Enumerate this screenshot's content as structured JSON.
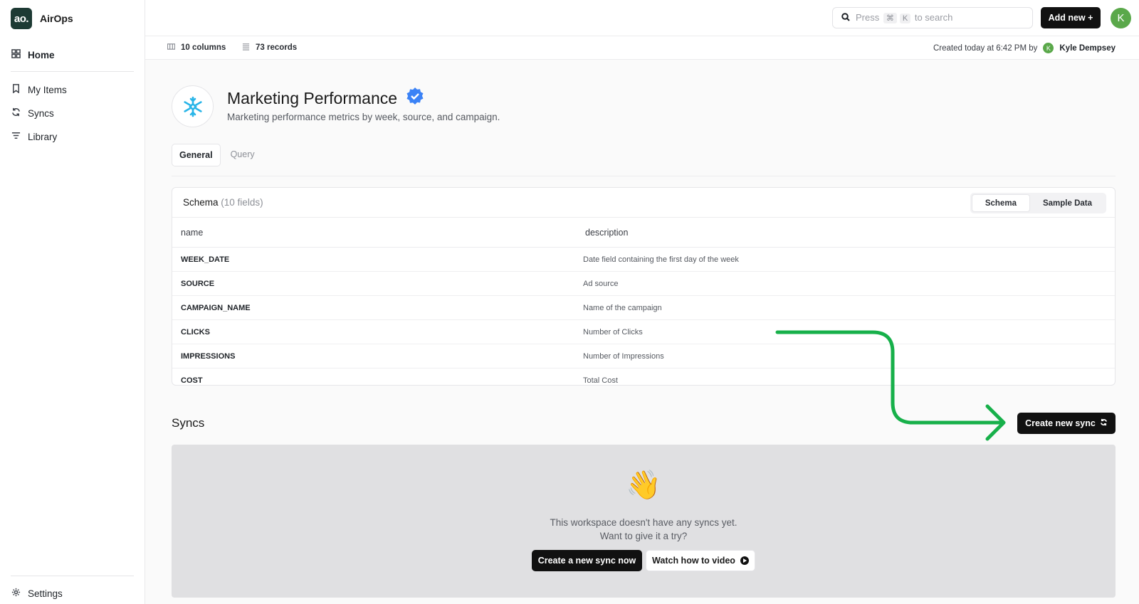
{
  "app": {
    "logo_text": "ao.",
    "name": "AirOps"
  },
  "sidebar": {
    "items": [
      {
        "label": "Home",
        "icon": "grid-icon"
      },
      {
        "label": "My Items",
        "icon": "bookmark-icon"
      },
      {
        "label": "Syncs",
        "icon": "sync-icon"
      },
      {
        "label": "Library",
        "icon": "filter-icon"
      }
    ],
    "settings_label": "Settings"
  },
  "topbar": {
    "search": {
      "prefix": "Press",
      "key1": "⌘",
      "key2": "K",
      "suffix": "to search"
    },
    "add_new_label": "Add new +",
    "avatar_initial": "K"
  },
  "infobar": {
    "columns": "10 columns",
    "records": "73 records",
    "created_text": "Created today at 6:42 PM by",
    "user_initial": "K",
    "user_name": "Kyle Dempsey"
  },
  "header": {
    "title": "Marketing Performance",
    "subtitle": "Marketing performance metrics by week, source, and campaign."
  },
  "tabs": [
    {
      "label": "General"
    },
    {
      "label": "Query"
    }
  ],
  "schema": {
    "title": "Schema",
    "count": "(10 fields)",
    "toggle": [
      "Schema",
      "Sample Data"
    ],
    "columns": [
      "name",
      "description"
    ],
    "rows": [
      {
        "name": "WEEK_DATE",
        "description": "Date field containing the first day of the week"
      },
      {
        "name": "SOURCE",
        "description": "Ad source"
      },
      {
        "name": "CAMPAIGN_NAME",
        "description": "Name of the campaign"
      },
      {
        "name": "CLICKS",
        "description": "Number of Clicks"
      },
      {
        "name": "IMPRESSIONS",
        "description": "Number of Impressions"
      },
      {
        "name": "COST",
        "description": "Total Cost"
      }
    ]
  },
  "syncs": {
    "title": "Syncs",
    "create_label": "Create new sync",
    "empty_line1": "This workspace doesn't have any syncs yet.",
    "empty_line2": "Want to give it a try?",
    "create_now_label": "Create a new sync now",
    "video_label": "Watch how to video",
    "emoji": "👋"
  },
  "colors": {
    "accent_green": "#17b04a",
    "verified_blue": "#3b82f6",
    "snowflake_blue": "#29b5e8"
  }
}
